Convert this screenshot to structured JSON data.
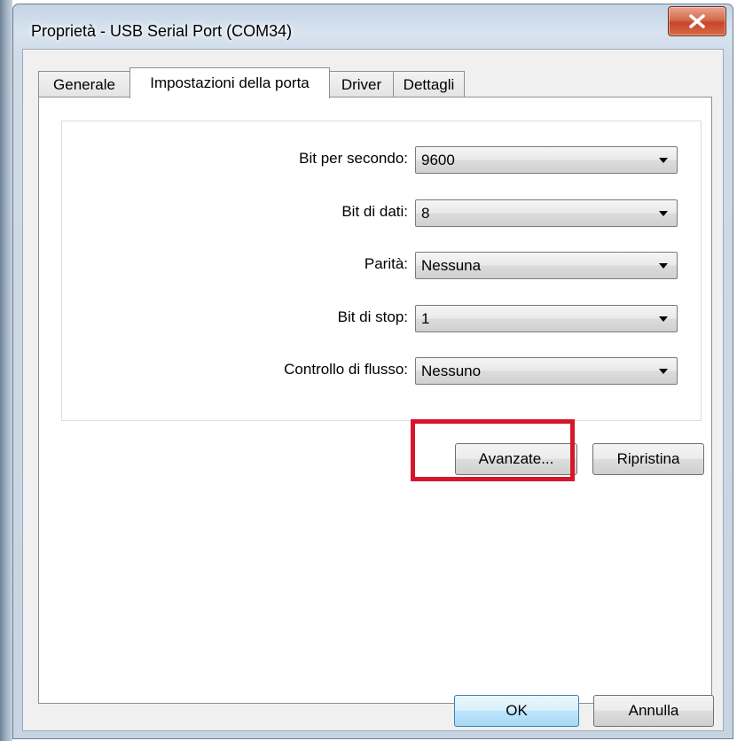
{
  "window": {
    "title": "Proprietà - USB Serial Port (COM34)",
    "close_icon": "close-x-icon"
  },
  "tabs": [
    {
      "label": "Generale"
    },
    {
      "label": "Impostazioni della porta"
    },
    {
      "label": "Driver"
    },
    {
      "label": "Dettagli"
    }
  ],
  "active_tab": "Impostazioni della porta",
  "settings": [
    {
      "label": "Bit per secondo:",
      "value": "9600"
    },
    {
      "label": "Bit di dati:",
      "value": "8"
    },
    {
      "label": "Parità:",
      "value": "Nessuna"
    },
    {
      "label": "Bit di stop:",
      "value": "1"
    },
    {
      "label": "Controllo di flusso:",
      "value": "Nessuno"
    }
  ],
  "buttons": {
    "advanced": "Avanzate...",
    "restore": "Ripristina",
    "ok": "OK",
    "cancel": "Annulla"
  },
  "colors": {
    "highlight": "#d6172b",
    "close_button": "#c7462b"
  }
}
